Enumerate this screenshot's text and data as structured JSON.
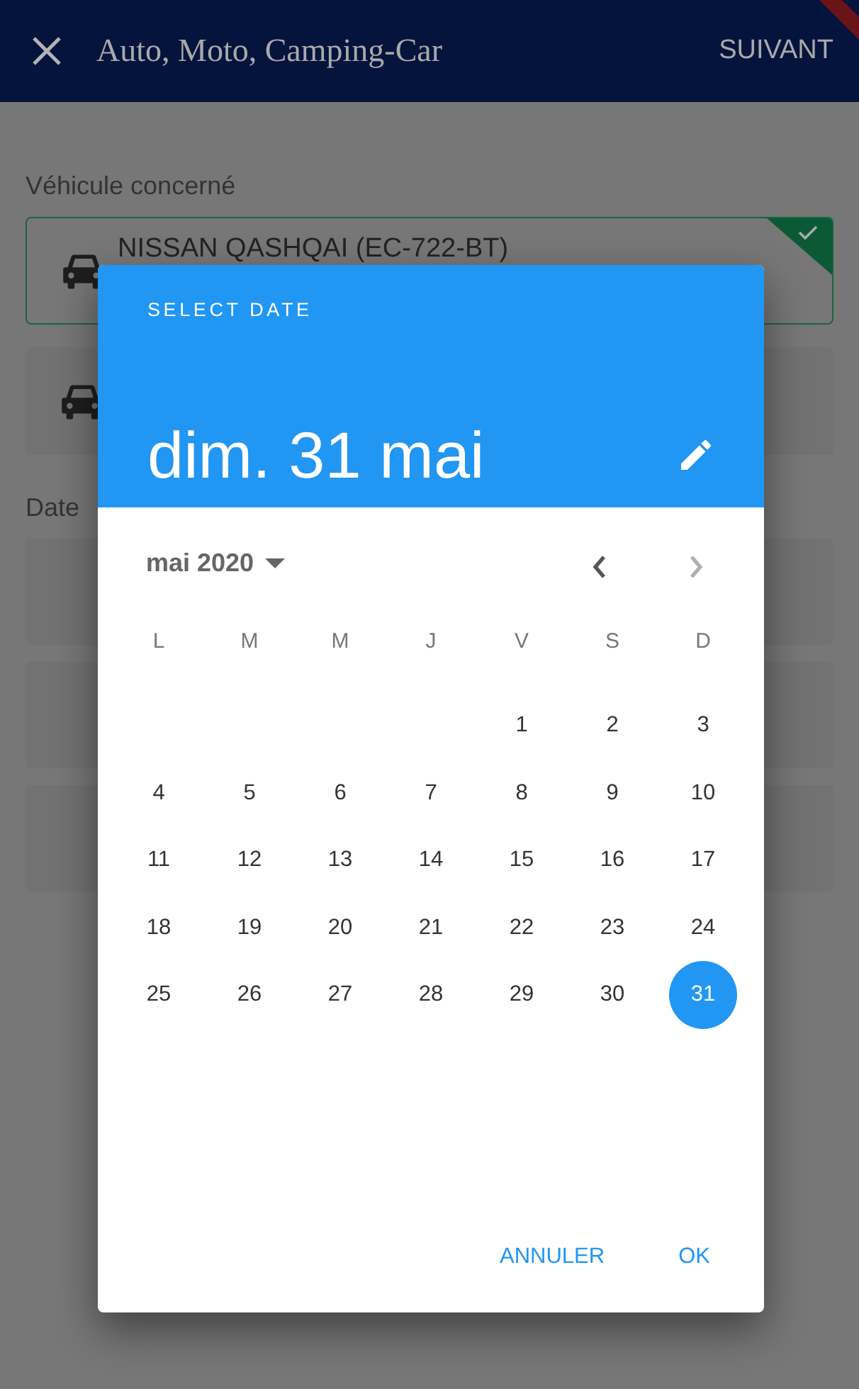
{
  "app_bar": {
    "title": "Auto, Moto, Camping-Car",
    "action": "SUIVANT"
  },
  "form": {
    "vehicle_label": "Véhicule concerné",
    "vehicles": [
      {
        "name": "NISSAN QASHQAI (EC-722-BT)",
        "selected": true
      },
      {
        "selected": false
      }
    ],
    "date_label": "Date"
  },
  "dialog": {
    "header_label": "SELECT DATE",
    "selected_date": "dim. 31 mai",
    "month": "mai 2020",
    "nav": [
      {
        "kind": "prev",
        "disabled": false
      },
      {
        "kind": "next",
        "disabled": true
      }
    ],
    "weekdays": [
      "L",
      "M",
      "M",
      "J",
      "V",
      "S",
      "D"
    ],
    "weeks": [
      [
        {
          "day": "1",
          "selected": false
        },
        {
          "day": "2",
          "selected": false
        },
        {
          "day": "3",
          "selected": false
        }
      ],
      [
        {
          "day": "4",
          "selected": false
        },
        {
          "day": "5",
          "selected": false
        },
        {
          "day": "6",
          "selected": false
        },
        {
          "day": "7",
          "selected": false
        },
        {
          "day": "8",
          "selected": false
        },
        {
          "day": "9",
          "selected": false
        },
        {
          "day": "10",
          "selected": false
        }
      ],
      [
        {
          "day": "11",
          "selected": false
        },
        {
          "day": "12",
          "selected": false
        },
        {
          "day": "13",
          "selected": false
        },
        {
          "day": "14",
          "selected": false
        },
        {
          "day": "15",
          "selected": false
        },
        {
          "day": "16",
          "selected": false
        },
        {
          "day": "17",
          "selected": false
        }
      ],
      [
        {
          "day": "18",
          "selected": false
        },
        {
          "day": "19",
          "selected": false
        },
        {
          "day": "20",
          "selected": false
        },
        {
          "day": "21",
          "selected": false
        },
        {
          "day": "22",
          "selected": false
        },
        {
          "day": "23",
          "selected": false
        },
        {
          "day": "24",
          "selected": false
        }
      ],
      [
        {
          "day": "25",
          "selected": false
        },
        {
          "day": "26",
          "selected": false
        },
        {
          "day": "27",
          "selected": false
        },
        {
          "day": "28",
          "selected": false
        },
        {
          "day": "29",
          "selected": false
        },
        {
          "day": "30",
          "selected": false
        },
        {
          "day": "31",
          "selected": true
        }
      ]
    ],
    "buttons": [
      "ANNULER",
      "OK"
    ]
  }
}
